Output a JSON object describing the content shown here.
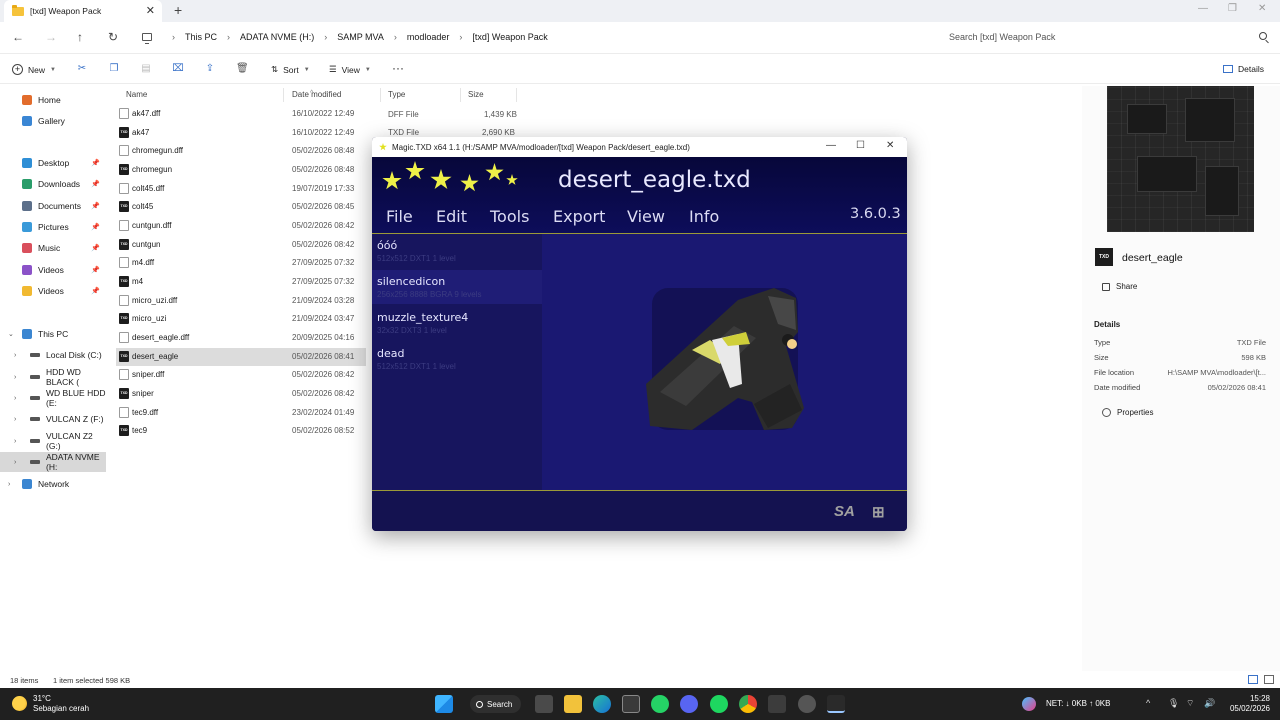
{
  "explorer": {
    "tab_title": "[txd] Weapon Pack",
    "new_tab": "+",
    "breadcrumb": [
      "This PC",
      "ADATA NVME (H:)",
      "SAMP MVA",
      "modloader",
      "[txd] Weapon Pack"
    ],
    "search_placeholder": "Search [txd] Weapon Pack",
    "toolbar": {
      "new": "New",
      "sort": "Sort",
      "view": "View",
      "more": "···",
      "details": "Details"
    },
    "nav": {
      "home": "Home",
      "gallery": "Gallery",
      "quick": [
        "Desktop",
        "Downloads",
        "Documents",
        "Pictures",
        "Music",
        "Videos",
        "Videos"
      ],
      "this_pc": "This PC",
      "drives": [
        "Local Disk (C:)",
        "HDD WD BLACK (",
        "WD BLUE HDD (E:",
        "VULCAN Z (F:)",
        "VULCAN Z2 (G:)",
        "ADATA NVME (H:"
      ],
      "network": "Network"
    },
    "columns": {
      "name": "Name",
      "date": "Date modified",
      "type": "Type",
      "size": "Size"
    },
    "files": [
      {
        "name": "ak47.dff",
        "date": "16/10/2022 12:49",
        "icon": "dff-file-icon"
      },
      {
        "name": "ak47",
        "date": "16/10/2022 12:49",
        "icon": "txd-file-icon"
      },
      {
        "name": "chromegun.dff",
        "date": "05/02/2026 08:48",
        "icon": "dff-file-icon"
      },
      {
        "name": "chromegun",
        "date": "05/02/2026 08:48",
        "icon": "txd-file-icon"
      },
      {
        "name": "colt45.dff",
        "date": "19/07/2019 17:33",
        "icon": "dff-file-icon"
      },
      {
        "name": "colt45",
        "date": "05/02/2026 08:45",
        "icon": "txd-file-icon"
      },
      {
        "name": "cuntgun.dff",
        "date": "05/02/2026 08:42",
        "icon": "dff-file-icon"
      },
      {
        "name": "cuntgun",
        "date": "05/02/2026 08:42",
        "icon": "txd-file-icon"
      },
      {
        "name": "m4.dff",
        "date": "27/09/2025 07:32",
        "icon": "dff-file-icon"
      },
      {
        "name": "m4",
        "date": "27/09/2025 07:32",
        "icon": "txd-file-icon"
      },
      {
        "name": "micro_uzi.dff",
        "date": "21/09/2024 03:28",
        "icon": "dff-file-icon"
      },
      {
        "name": "micro_uzi",
        "date": "21/09/2024 03:47",
        "icon": "txd-file-icon"
      },
      {
        "name": "desert_eagle.dff",
        "date": "20/09/2025 04:16",
        "icon": "dff-file-icon"
      },
      {
        "name": "desert_eagle",
        "date": "05/02/2026 08:41",
        "icon": "txd-file-icon",
        "selected": true
      },
      {
        "name": "sniper.dff",
        "date": "05/02/2026 08:42",
        "icon": "dff-file-icon"
      },
      {
        "name": "sniper",
        "date": "05/02/2026 08:42",
        "icon": "txd-file-icon"
      },
      {
        "name": "tec9.dff",
        "date": "23/02/2024 01:49",
        "icon": "dff-file-icon"
      },
      {
        "name": "tec9",
        "date": "05/02/2026 08:52",
        "icon": "txd-file-icon"
      }
    ],
    "visible_types": [
      {
        "type": "DFF File",
        "size": "1,439 KB"
      },
      {
        "type": "TXD File",
        "size": "2,690 KB"
      }
    ],
    "status": {
      "items": "18 items",
      "selected": "1 item selected  598 KB"
    },
    "details": {
      "name": "desert_eagle",
      "share": "Share",
      "section": "Details",
      "rows": [
        {
          "label": "Type",
          "value": "TXD File"
        },
        {
          "label": "Size",
          "value": "598 KB"
        },
        {
          "label": "File location",
          "value": "H:\\SAMP MVA\\modloader\\[t..."
        },
        {
          "label": "Date modified",
          "value": "05/02/2026 08:41"
        }
      ],
      "properties": "Properties"
    }
  },
  "magictxd": {
    "title": "Magic.TXD x64 1.1 (H:/SAMP MVA/modloader/[txd] Weapon Pack/desert_eagle.txd)",
    "file": "desert_eagle.txd",
    "menu": [
      "File",
      "Edit",
      "Tools",
      "Export",
      "View",
      "Info"
    ],
    "version": "3.6.0.3",
    "textures": [
      {
        "name": "óóó",
        "meta": "512x512 DXT1 1 level"
      },
      {
        "name": "silencedicon",
        "meta": "256x256 8888 BGRA 9 levels"
      },
      {
        "name": "muzzle_texture4",
        "meta": "32x32 DXT3 1 level"
      },
      {
        "name": "dead",
        "meta": "512x512 DXT1 1 level"
      }
    ],
    "footer_logo": "SA",
    "colors": {
      "bg": "#0c0c3a",
      "accent": "#eef048",
      "preview": "#1a1872"
    }
  },
  "taskbar": {
    "weather_temp": "31°C",
    "weather_desc": "Sebagian cerah",
    "search": "Search",
    "net": "NET: ↓ 0KB ↑ 0KB",
    "time": "15:28",
    "date": "05/02/2026"
  }
}
